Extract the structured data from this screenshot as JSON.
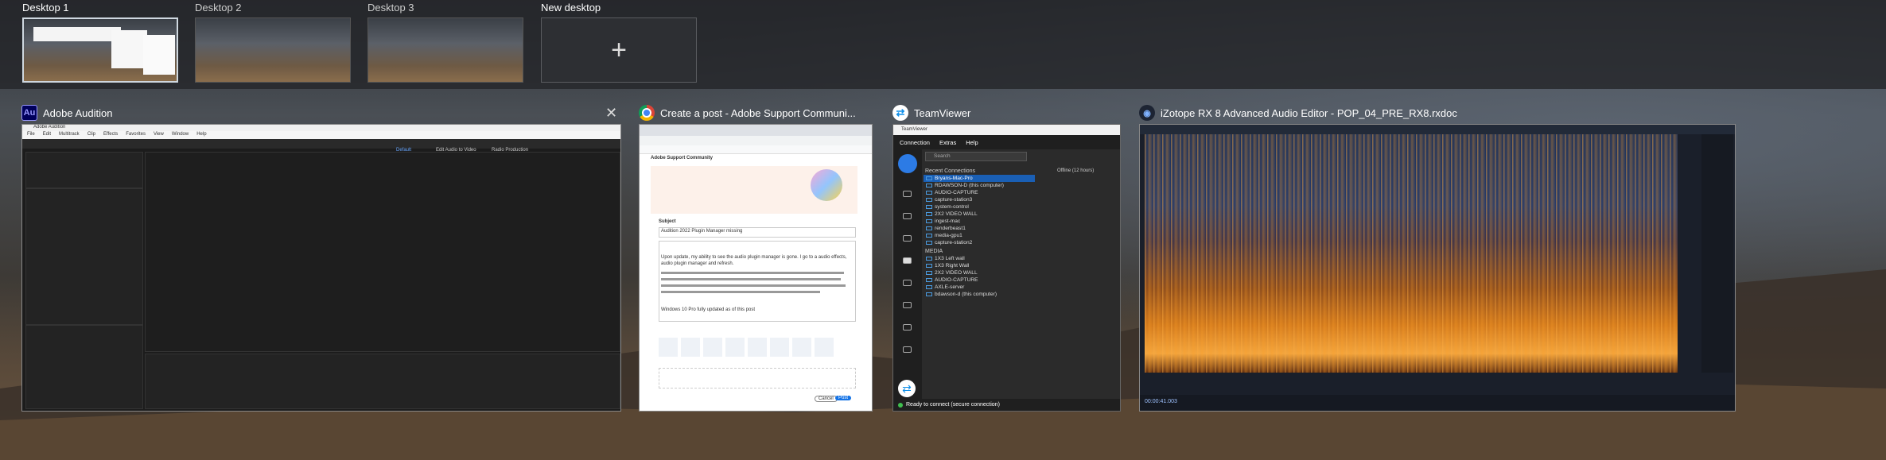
{
  "desktops": [
    {
      "label": "Desktop 1",
      "active": true
    },
    {
      "label": "Desktop 2",
      "active": false
    },
    {
      "label": "Desktop 3",
      "active": false
    }
  ],
  "new_desktop": {
    "label": "New desktop",
    "icon": "plus-icon",
    "glyph": "+"
  },
  "windows": {
    "audition": {
      "icon_text": "Au",
      "icon_color": "#9999ff",
      "title": "Adobe Audition",
      "close_glyph": "✕",
      "inner_title": "Adobe Audition",
      "menu": [
        "File",
        "Edit",
        "Multitrack",
        "Clip",
        "Effects",
        "Favorites",
        "View",
        "Window",
        "Help"
      ],
      "workspaces": [
        "Default",
        "Edit Audio to Video",
        "Radio Production"
      ]
    },
    "chrome": {
      "title": "Create a post - Adobe Support Communi...",
      "site_header": "Adobe Support Community",
      "subject_label": "Subject",
      "subject_value": "Audition 2022 Plugin Manager missing",
      "body_text": "Upon update, my ability to see the audio plugin manager is gone. I go to a audio effects, audio plugin manager and refresh.",
      "footer_text": "Windows 10 Pro fully updated as of this post",
      "cancel": "Cancel",
      "post": "Post"
    },
    "teamviewer": {
      "title": "TeamViewer",
      "app_name": "TeamViewer",
      "menu": [
        "Connection",
        "Extras",
        "Help"
      ],
      "search_placeholder": "Search",
      "recent_header": "Recent Connections",
      "recent": [
        "Bryans-Mac-Pro",
        "RDAWSON-D (this computer)",
        "AUDIO-CAPTURE",
        "capture-station3",
        "system-control",
        "2X2 VIDEO WALL",
        "ingest-mac",
        "renderbeast1",
        "media-gpu1",
        "capture-station2"
      ],
      "media_header": "MEDIA",
      "media": [
        "1X3 Left wall",
        "1X3 Right Wall",
        "2X2 VIDEO WALL",
        "AUDIO-CAPTURE",
        "AXLE-server",
        "bdawson-d (this computer)"
      ],
      "status": "Ready to connect (secure connection)",
      "offline_text": "Offline (12 hours)"
    },
    "izotope": {
      "title": "iZotope RX 8 Advanced Audio Editor - POP_04_PRE_RX8.rxdoc",
      "time": "00:00:41.003"
    }
  }
}
